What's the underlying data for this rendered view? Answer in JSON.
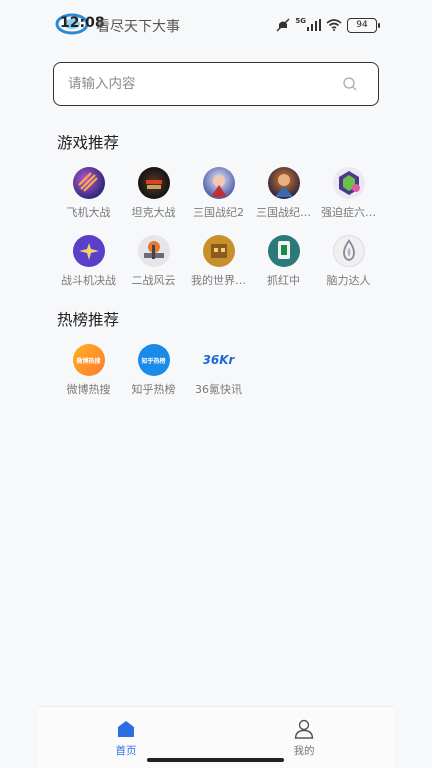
{
  "status": {
    "time": "12:08",
    "app_title": "看尽天下大事",
    "network": "5G",
    "battery": "94"
  },
  "search": {
    "placeholder": "请输入内容"
  },
  "games_section": {
    "title": "游戏推荐",
    "items": [
      {
        "label": "飞机大战",
        "icon": "plane-game-icon"
      },
      {
        "label": "坦克大战",
        "icon": "tank-game-icon"
      },
      {
        "label": "三国战纪2",
        "icon": "three-kingdoms-2-icon"
      },
      {
        "label": "三国战纪…",
        "icon": "three-kingdoms-icon"
      },
      {
        "label": "强迫症六…",
        "icon": "hexagon-puzzle-icon"
      },
      {
        "label": "战斗机决战",
        "icon": "fighter-jet-icon"
      },
      {
        "label": "二战风云",
        "icon": "ww2-game-icon"
      },
      {
        "label": "我的世界…",
        "icon": "minecraft-icon"
      },
      {
        "label": "抓红中",
        "icon": "mahjong-icon"
      },
      {
        "label": "脑力达人",
        "icon": "brain-master-icon"
      }
    ]
  },
  "hot_section": {
    "title": "热榜推荐",
    "items": [
      {
        "label": "微博热搜",
        "icon": "weibo-icon",
        "badge": "微博热搜"
      },
      {
        "label": "知乎热榜",
        "icon": "zhihu-icon",
        "badge": "知乎热榜"
      },
      {
        "label": "36氪快讯",
        "icon": "36kr-icon",
        "badge": "36Kr"
      }
    ]
  },
  "tabbar": {
    "home": "首页",
    "mine": "我的",
    "active_color": "#2f6ee0"
  }
}
